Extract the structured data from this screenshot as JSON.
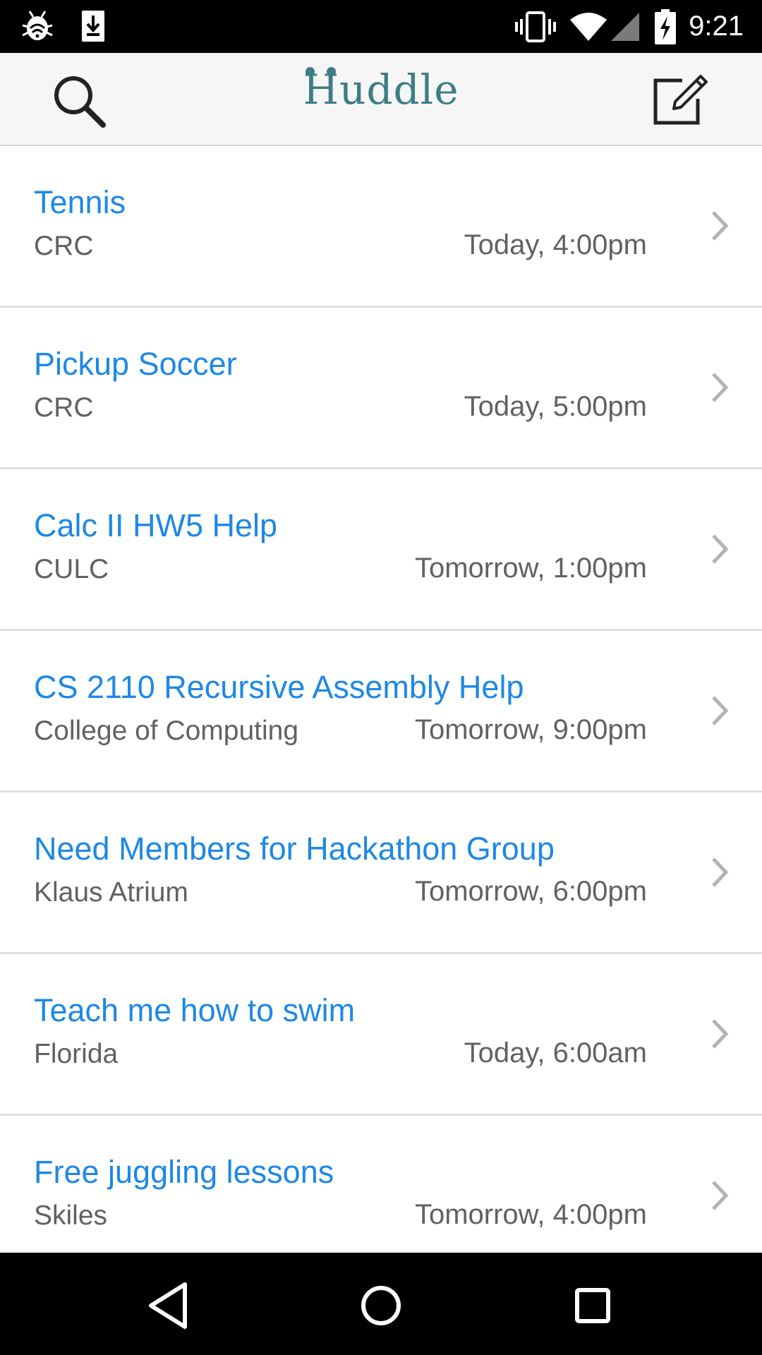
{
  "status_bar": {
    "time": "9:21",
    "left_icons": [
      "debug-bug-icon",
      "download-icon"
    ],
    "right_icons": [
      "vibrate-icon",
      "wifi-icon",
      "cell-signal-icon",
      "battery-charging-icon"
    ]
  },
  "app_bar": {
    "logo": "Huddle",
    "search_icon": "search-icon",
    "compose_icon": "compose-icon"
  },
  "colors": {
    "title": "#1e88e5",
    "secondary": "#616161",
    "logo": "#3c7d86"
  },
  "events": [
    {
      "title": "Tennis",
      "location": "CRC",
      "time": "Today, 4:00pm"
    },
    {
      "title": "Pickup Soccer",
      "location": "CRC",
      "time": "Today, 5:00pm"
    },
    {
      "title": "Calc II HW5 Help",
      "location": "CULC",
      "time": "Tomorrow, 1:00pm"
    },
    {
      "title": "CS 2110 Recursive Assembly Help",
      "location": "College of Computing",
      "time": "Tomorrow, 9:00pm"
    },
    {
      "title": "Need Members for Hackathon Group",
      "location": "Klaus Atrium",
      "time": "Tomorrow, 6:00pm"
    },
    {
      "title": "Teach me how to swim",
      "location": "Florida",
      "time": "Today, 6:00am"
    },
    {
      "title": "Free juggling lessons",
      "location": "Skiles",
      "time": "Tomorrow, 4:00pm"
    }
  ],
  "nav_bar": {
    "buttons": [
      "back-icon",
      "home-icon",
      "recents-icon"
    ]
  }
}
